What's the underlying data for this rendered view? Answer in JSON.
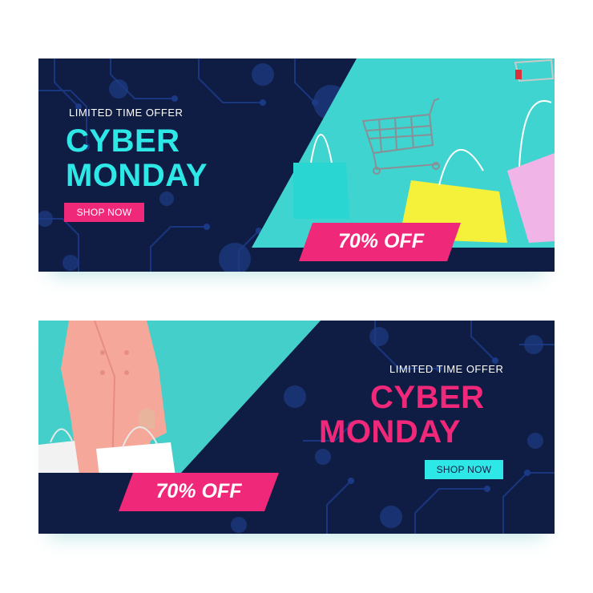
{
  "banners": [
    {
      "offer_label": "LIMITED TIME OFFER",
      "title_line1": "CYBER",
      "title_line2": "MONDAY",
      "button_label": "SHOP NOW",
      "discount_label": "70% OFF",
      "title_color": "#2ee8e8",
      "button_bg": "#f0287a",
      "button_text_color": "#ffffff"
    },
    {
      "offer_label": "LIMITED TIME OFFER",
      "title_line1": "CYBER",
      "title_line2": "MONDAY",
      "button_label": "SHOP NOW",
      "discount_label": "70% OFF",
      "title_color": "#f0287a",
      "button_bg": "#2ee8e8",
      "button_text_color": "#0f1d45"
    }
  ],
  "colors": {
    "navy": "#0f1d45",
    "cyan": "#2ee8e8",
    "pink": "#f0287a",
    "teal_photo_bg": "#3fd0cc"
  }
}
